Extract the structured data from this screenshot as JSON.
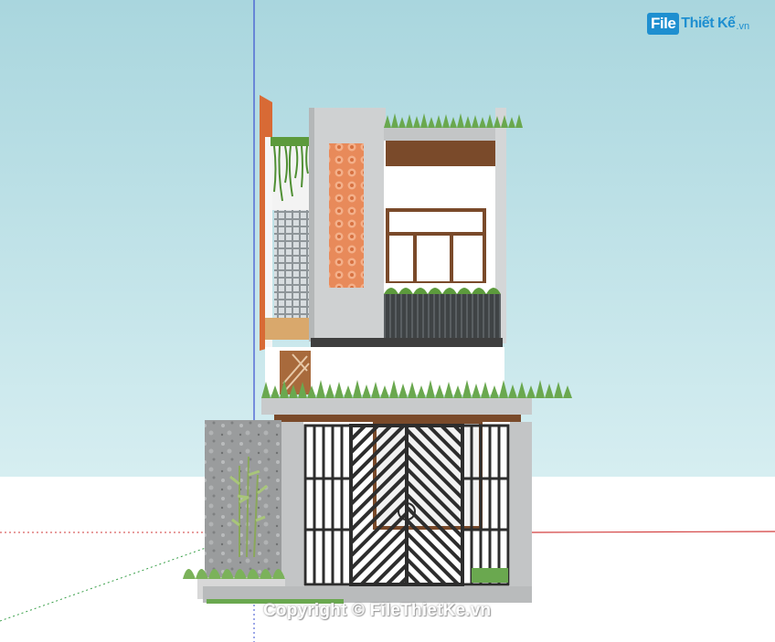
{
  "watermark": {
    "logo_box": "File",
    "logo_rest": "Thiết Kế",
    "logo_tld": ".vn",
    "copyright": "Copyright © FileThietKe.vn"
  },
  "colors": {
    "sky": "#bfe0e6",
    "ground": "#ffffff",
    "concrete": "#c9cccd",
    "brick": "#e88a5a",
    "foliage": "#6aa84f",
    "gate": "#2d2d2d",
    "wood": "#7a4a2a",
    "watermark_blue": "#1e8fd0"
  }
}
